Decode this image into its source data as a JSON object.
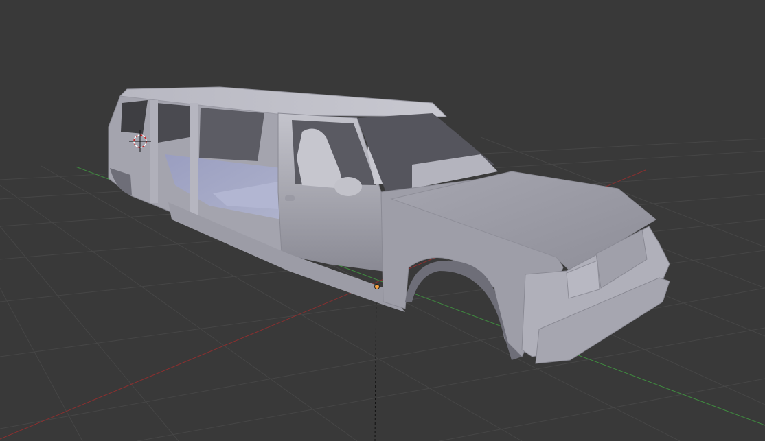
{
  "app": {
    "name": "3D Viewport",
    "background_color": "#393939"
  },
  "scene": {
    "object_type": "vehicle-mesh",
    "shading": "solid",
    "grid": true,
    "axes": {
      "x_color": "#8c2f2f",
      "y_color": "#3f8c3f"
    },
    "mesh_color": "#b4b4c0",
    "cursor_color": "#cc2222",
    "origin_color": "#f5a040"
  }
}
